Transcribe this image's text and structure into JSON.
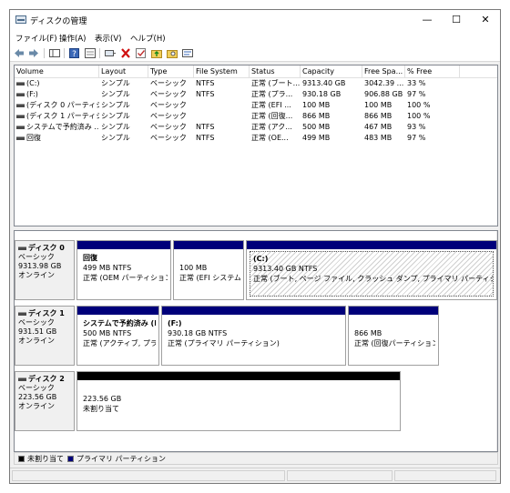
{
  "window": {
    "title": "ディスクの管理",
    "minimize": "—",
    "maximize": "☐",
    "close": "✕"
  },
  "menu": [
    "ファイル(F)",
    "操作(A)",
    "表示(V)",
    "ヘルプ(H)"
  ],
  "toolbar_icons": [
    "back-arrow-icon",
    "forward-arrow-icon",
    "console-tree-icon",
    "help-icon",
    "properties-icon",
    "connect-icon",
    "delete-icon",
    "check-icon",
    "up-folder-icon",
    "search-folder-icon",
    "view-icon"
  ],
  "volume_list": {
    "columns": [
      "Volume",
      "Layout",
      "Type",
      "File System",
      "Status",
      "Capacity",
      "Free Spa...",
      "% Free"
    ],
    "rows": [
      {
        "volume": "(C:)",
        "layout": "シンプル",
        "type": "ベーシック",
        "fs": "NTFS",
        "status": "正常 (ブート...",
        "capacity": "9313.40 GB",
        "free": "3042.39 ...",
        "pct": "33 %"
      },
      {
        "volume": "(F:)",
        "layout": "シンプル",
        "type": "ベーシック",
        "fs": "NTFS",
        "status": "正常 (プラ...",
        "capacity": "930.18 GB",
        "free": "906.88 GB",
        "pct": "97 %"
      },
      {
        "volume": "(ディスク 0 パーティシ...",
        "layout": "シンプル",
        "type": "ベーシック",
        "fs": "",
        "status": "正常 (EFI ...",
        "capacity": "100 MB",
        "free": "100 MB",
        "pct": "100 %"
      },
      {
        "volume": "(ディスク 1 パーティシ...",
        "layout": "シンプル",
        "type": "ベーシック",
        "fs": "",
        "status": "正常 (回復...",
        "capacity": "866 MB",
        "free": "866 MB",
        "pct": "100 %"
      },
      {
        "volume": "システムで予約済み ...",
        "layout": "シンプル",
        "type": "ベーシック",
        "fs": "NTFS",
        "status": "正常 (アク...",
        "capacity": "500 MB",
        "free": "467 MB",
        "pct": "93 %"
      },
      {
        "volume": "回復",
        "layout": "シンプル",
        "type": "ベーシック",
        "fs": "NTFS",
        "status": "正常 (OE...",
        "capacity": "499 MB",
        "free": "483 MB",
        "pct": "97 %"
      }
    ]
  },
  "disks": [
    {
      "name": "ディスク 0",
      "type": "ベーシック",
      "size": "9313.98 GB",
      "state": "オンライン",
      "partitions": [
        {
          "name": "回復",
          "size": "499 MB NTFS",
          "status": "正常 (OEM パーティション)"
        },
        {
          "name": "",
          "size": "100 MB",
          "status": "正常 (EFI システム / "
        },
        {
          "name": "(C:)",
          "size": "9313.40 GB NTFS",
          "status": "正常 (ブート, ページ ファイル, クラッシュ ダンプ, プライマリ パーティション)"
        }
      ]
    },
    {
      "name": "ディスク 1",
      "type": "ベーシック",
      "size": "931.51 GB",
      "state": "オンライン",
      "partitions": [
        {
          "name": "システムで予約済み (D",
          "size": "500 MB NTFS",
          "status": "正常 (アクティブ, プライマ"
        },
        {
          "name": "(F:)",
          "size": "930.18 GB NTFS",
          "status": "正常 (プライマリ パーティション)"
        },
        {
          "name": "",
          "size": "866 MB",
          "status": "正常 (回復パーティション)"
        }
      ]
    },
    {
      "name": "ディスク 2",
      "type": "ベーシック",
      "size": "223.56 GB",
      "state": "オンライン",
      "partitions": [
        {
          "name": "",
          "size": "223.56 GB",
          "status": "未割り当て"
        }
      ]
    }
  ],
  "legend": {
    "unallocated": "未割り当て",
    "primary": "プライマリ パーティション"
  },
  "colors": {
    "primary_bar": "#00007a",
    "unallocated_bar": "#000000"
  }
}
